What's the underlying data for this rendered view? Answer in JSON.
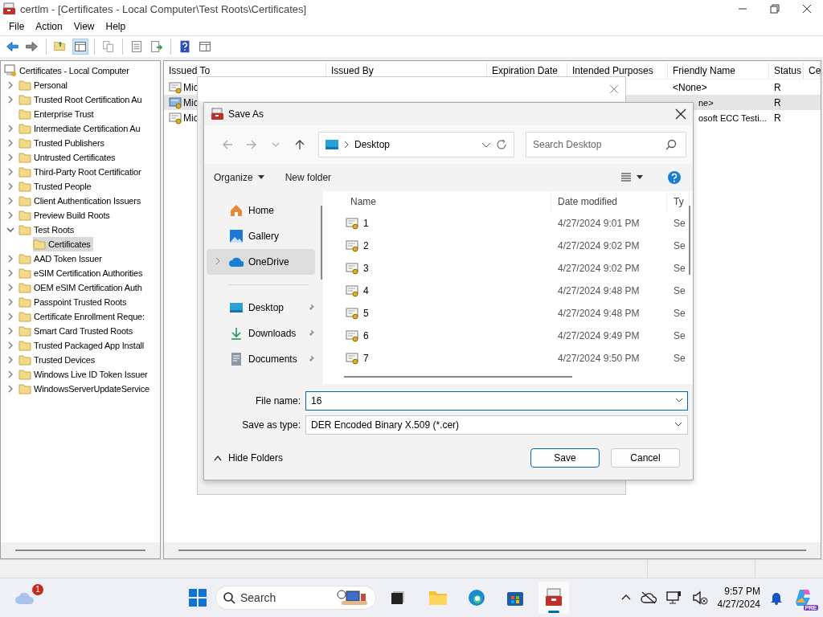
{
  "window": {
    "title": "certlm - [Certificates - Local Computer\\Test Roots\\Certificates]"
  },
  "menu": [
    "File",
    "Action",
    "View",
    "Help"
  ],
  "toolbar": [
    {
      "kind": "back",
      "selected": false
    },
    {
      "kind": "forward",
      "selected": false
    },
    {
      "kind": "separator"
    },
    {
      "kind": "up",
      "selected": false
    },
    {
      "kind": "tree",
      "selected": true
    },
    {
      "kind": "separator"
    },
    {
      "kind": "copy",
      "selected": false
    },
    {
      "kind": "separator"
    },
    {
      "kind": "properties",
      "selected": false
    },
    {
      "kind": "export",
      "selected": false
    },
    {
      "kind": "separator"
    },
    {
      "kind": "help",
      "selected": false
    },
    {
      "kind": "view",
      "selected": false
    }
  ],
  "tree": {
    "label": "Certificates - Local Computer",
    "children": [
      {
        "label": "Personal",
        "expandable": true,
        "expanded": false,
        "selected": false
      },
      {
        "label": "Trusted Root Certification Au",
        "expandable": true,
        "expanded": false,
        "selected": false
      },
      {
        "label": "Enterprise Trust",
        "expandable": false,
        "selected": false
      },
      {
        "label": "Intermediate Certification Au",
        "expandable": true,
        "expanded": false,
        "selected": false
      },
      {
        "label": "Trusted Publishers",
        "expandable": true,
        "expanded": false,
        "selected": false
      },
      {
        "label": "Untrusted Certificates",
        "expandable": true,
        "expanded": false,
        "selected": false
      },
      {
        "label": "Third-Party Root Certificatior",
        "expandable": true,
        "expanded": false,
        "selected": false
      },
      {
        "label": "Trusted People",
        "expandable": true,
        "expanded": false,
        "selected": false
      },
      {
        "label": "Client Authentication Issuers",
        "expandable": true,
        "expanded": false,
        "selected": false
      },
      {
        "label": "Preview Build Roots",
        "expandable": true,
        "expanded": false,
        "selected": false
      },
      {
        "label": "Test Roots",
        "expandable": true,
        "expanded": true,
        "selected": false,
        "children": [
          {
            "label": "Certificates",
            "expandable": false,
            "selected": true
          }
        ]
      },
      {
        "label": "AAD Token Issuer",
        "expandable": true,
        "expanded": false,
        "selected": false
      },
      {
        "label": "eSIM Certification Authorities",
        "expandable": true,
        "expanded": false,
        "selected": false
      },
      {
        "label": "OEM eSIM Certification Auth",
        "expandable": true,
        "expanded": false,
        "selected": false
      },
      {
        "label": "Passpoint Trusted Roots",
        "expandable": true,
        "expanded": false,
        "selected": false
      },
      {
        "label": "Certificate Enrollment Reque:",
        "expandable": true,
        "expanded": false,
        "selected": false
      },
      {
        "label": "Smart Card Trusted Roots",
        "expandable": true,
        "expanded": false,
        "selected": false
      },
      {
        "label": "Trusted Packaged App Install",
        "expandable": true,
        "expanded": false,
        "selected": false
      },
      {
        "label": "Trusted Devices",
        "expandable": true,
        "expanded": false,
        "selected": false
      },
      {
        "label": "Windows Live ID Token Issuer",
        "expandable": true,
        "expanded": false,
        "selected": false
      },
      {
        "label": "WindowsServerUpdateService",
        "expandable": true,
        "expanded": false,
        "selected": false
      }
    ]
  },
  "list": {
    "columns": [
      "Issued To",
      "Issued By",
      "Expiration Date",
      "Intended Purposes",
      "Friendly Name",
      "Status",
      "Ce"
    ],
    "rows": [
      {
        "issued_to": "Mic",
        "friendly_name": "<None>",
        "status": "R",
        "selected": false
      },
      {
        "issued_to": "Mic",
        "friendly_name": "ne>",
        "status": "R",
        "selected": true
      },
      {
        "issued_to": "Mic",
        "friendly_name": "osoft ECC Testi...",
        "status": "R",
        "selected": false
      }
    ]
  },
  "save_dialog": {
    "title": "Save As",
    "address": "Desktop",
    "search_placeholder": "Search Desktop",
    "commands": [
      "Organize",
      "New folder"
    ],
    "nav": [
      {
        "kind": "home",
        "label": "Home",
        "selected": false,
        "pinned": false,
        "expandable": false
      },
      {
        "kind": "gallery",
        "label": "Gallery",
        "selected": false,
        "pinned": false,
        "expandable": false
      },
      {
        "kind": "cloud",
        "label": "OneDrive",
        "selected": true,
        "pinned": false,
        "expandable": true
      },
      {
        "kind": "separator"
      },
      {
        "kind": "desktop",
        "label": "Desktop",
        "selected": false,
        "pinned": true,
        "expandable": false
      },
      {
        "kind": "download",
        "label": "Downloads",
        "selected": false,
        "pinned": true,
        "expandable": false
      },
      {
        "kind": "documents",
        "label": "Documents",
        "selected": false,
        "pinned": true,
        "expandable": false
      }
    ],
    "columns": [
      "Name",
      "Date modified",
      "Ty"
    ],
    "files": [
      {
        "name": "1",
        "modified": "4/27/2024 9:01 PM",
        "type": "Se"
      },
      {
        "name": "2",
        "modified": "4/27/2024 9:02 PM",
        "type": "Se"
      },
      {
        "name": "3",
        "modified": "4/27/2024 9:02 PM",
        "type": "Se"
      },
      {
        "name": "4",
        "modified": "4/27/2024 9:48 PM",
        "type": "Se"
      },
      {
        "name": "5",
        "modified": "4/27/2024 9:48 PM",
        "type": "Se"
      },
      {
        "name": "6",
        "modified": "4/27/2024 9:49 PM",
        "type": "Se"
      },
      {
        "name": "7",
        "modified": "4/27/2024 9:50 PM",
        "type": "Se"
      }
    ],
    "file_name_label": "File name:",
    "file_name": "16",
    "save_type_label": "Save as type:",
    "save_type": "DER Encoded Binary X.509 (*.cer)",
    "hide_folders": "Hide Folders",
    "buttons": [
      "Save",
      "Cancel"
    ]
  },
  "taskbar": {
    "weather_badge": "1",
    "search_placeholder": "Search",
    "apps": [
      {
        "kind": "taskview",
        "selected": false
      },
      {
        "kind": "explorer",
        "selected": false
      },
      {
        "kind": "edge",
        "selected": false
      },
      {
        "kind": "store",
        "selected": false
      },
      {
        "kind": "certlm",
        "selected": true
      }
    ],
    "time": "9:57 PM",
    "date": "4/27/2024",
    "copilot_badge": "PRE"
  }
}
